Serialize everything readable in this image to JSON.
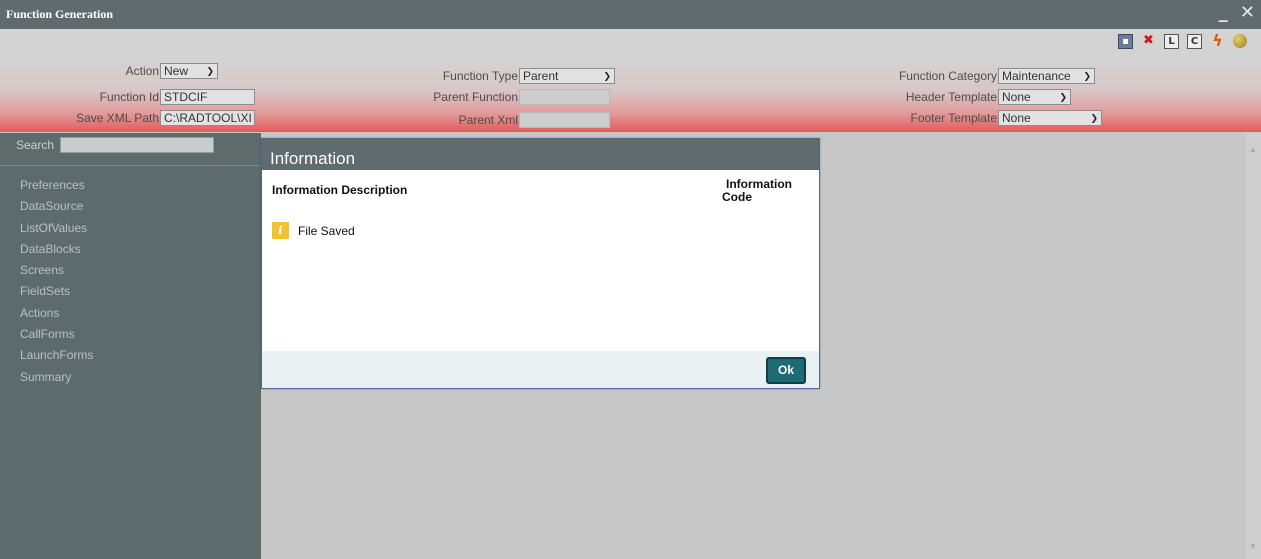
{
  "window": {
    "title": "Function Generation",
    "minimize_glyph": "_",
    "close_glyph": "✕"
  },
  "toolbar": {
    "icons": [
      "save-icon",
      "delete-icon",
      "l-icon",
      "c-icon",
      "generate-icon",
      "release-icon"
    ],
    "l_label": "L",
    "c_label": "C"
  },
  "form": {
    "action_label": "Action",
    "action_value": "New",
    "function_id_label": "Function Id",
    "function_id_value": "STDCIF",
    "save_xml_path_label": "Save XML Path",
    "save_xml_path_value": "C:\\RADTOOL\\XI",
    "function_type_label": "Function Type",
    "function_type_value": "Parent",
    "parent_function_label": "Parent Function",
    "parent_function_value": "",
    "parent_xml_label": "Parent Xml",
    "parent_xml_value": "",
    "function_category_label": "Function Category",
    "function_category_value": "Maintenance",
    "header_template_label": "Header Template",
    "header_template_value": "None",
    "footer_template_label": "Footer Template",
    "footer_template_value": "None"
  },
  "sidebar": {
    "search_label": "Search",
    "search_value": "",
    "items": [
      {
        "label": "Preferences"
      },
      {
        "label": "DataSource"
      },
      {
        "label": "ListOfValues"
      },
      {
        "label": "DataBlocks"
      },
      {
        "label": "Screens"
      },
      {
        "label": "FieldSets"
      },
      {
        "label": "Actions"
      },
      {
        "label": "CallForms"
      },
      {
        "label": "LaunchForms"
      },
      {
        "label": "Summary"
      }
    ]
  },
  "dialog": {
    "title": "Information",
    "col_description": "Information Description",
    "col_code_line1": "Information",
    "col_code_line2": "Code",
    "message_icon": "info-icon",
    "message_icon_glyph": "i",
    "message": "File Saved",
    "ok_label": "Ok"
  },
  "colors": {
    "title_bar": "#5f6b6e",
    "sidebar": "#5e6b6d",
    "band_red": "#e45a5a",
    "ok_button": "#1f6b75",
    "info_icon": "#f1c232"
  }
}
